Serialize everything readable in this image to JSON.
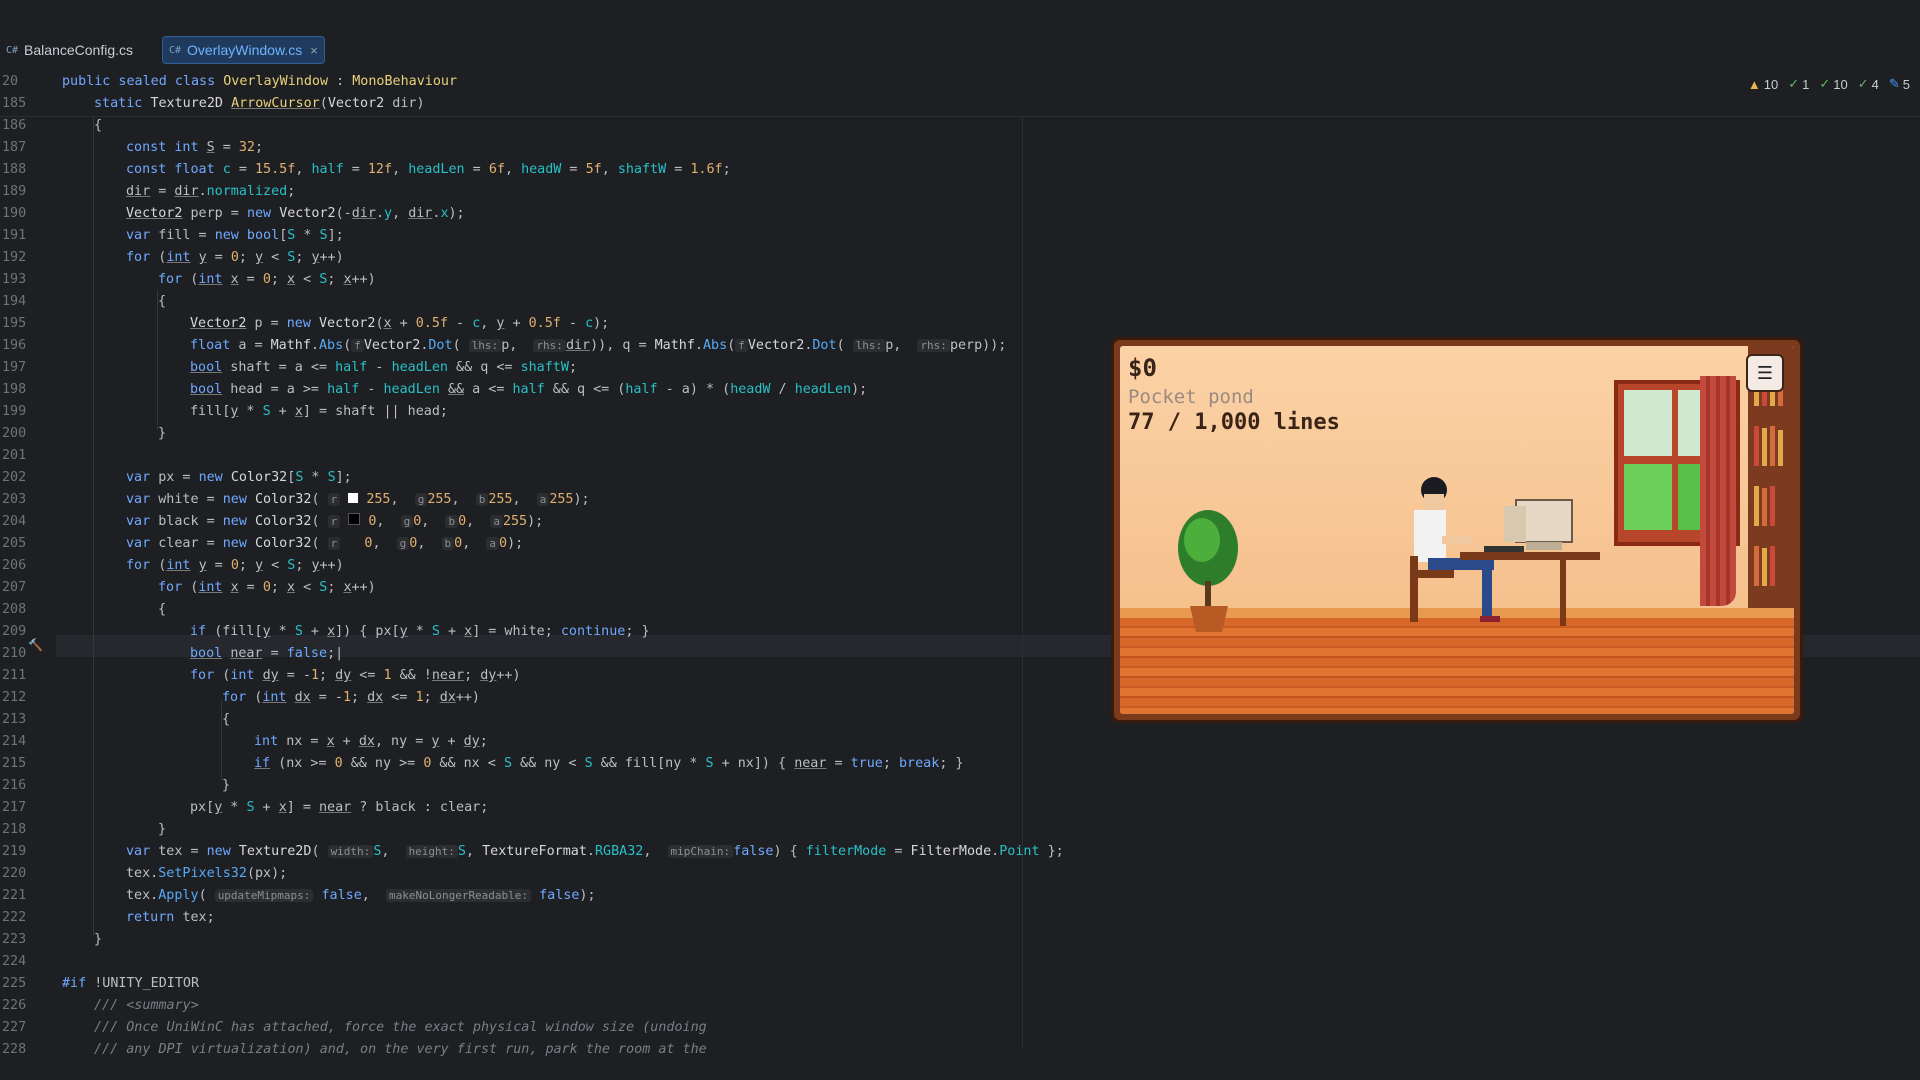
{
  "tabs": [
    {
      "icon": "C#",
      "label": "BalanceConfig.cs",
      "active": false
    },
    {
      "icon": "C#",
      "label": "OverlayWindow.cs",
      "active": true,
      "close": "×"
    }
  ],
  "inspections": {
    "warnings": "10",
    "ok1": "1",
    "weak": "10",
    "typo": "4",
    "edits": "5"
  },
  "sticky": [
    {
      "ln": "20",
      "text": "public sealed class OverlayWindow : MonoBehaviour"
    },
    {
      "ln": "185",
      "text": "static Texture2D ArrowCursor(Vector2 dir)"
    }
  ],
  "line_numbers": [
    "186",
    "187",
    "188",
    "189",
    "190",
    "191",
    "192",
    "193",
    "194",
    "195",
    "196",
    "197",
    "198",
    "199",
    "200",
    "201",
    "202",
    "203",
    "204",
    "205",
    "206",
    "207",
    "208",
    "209",
    "210",
    "211",
    "212",
    "213",
    "214",
    "215",
    "216",
    "217",
    "218",
    "219",
    "220",
    "221",
    "222",
    "223",
    "224",
    "225",
    "226",
    "227",
    "228"
  ],
  "overlay": {
    "money": "$0",
    "place": "Pocket pond",
    "progress": "77 / 1,000 lines",
    "menu_icon": "hamburger-icon"
  }
}
